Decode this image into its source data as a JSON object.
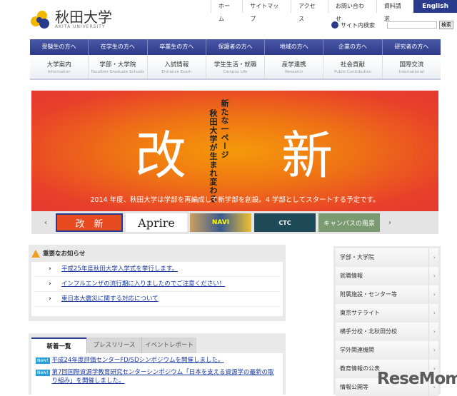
{
  "topbar": {
    "links": [
      "ホーム",
      "サイトマップ",
      "アクセス",
      "お問い合わせ",
      "資料請求"
    ],
    "english": "English"
  },
  "logo": {
    "name": "秋田大学",
    "sub": "AKITA UNIVERSITY"
  },
  "search": {
    "label": "サイト内検索",
    "button": "検索",
    "value": ""
  },
  "nav_primary": [
    "受験生の方へ",
    "在学生の方へ",
    "卒業生の方へ",
    "保護者の方へ",
    "地域の方へ",
    "企業の方へ",
    "研究者の方へ"
  ],
  "nav_secondary": [
    {
      "ja": "大学案内",
      "en": "Information"
    },
    {
      "ja": "学部・大学院",
      "en": "Faculties Graduate Schools"
    },
    {
      "ja": "入試情報",
      "en": "Entrance Exam"
    },
    {
      "ja": "学生生活・就職",
      "en": "Campus Life"
    },
    {
      "ja": "産学連携",
      "en": "Research"
    },
    {
      "ja": "社会貢献",
      "en": "Public Contribution"
    },
    {
      "ja": "国際交流",
      "en": "International"
    }
  ],
  "banner": {
    "big1": "改",
    "big2": "新",
    "vert1": "新たな一ページ",
    "vert2": "秋田大学が生まれ変わる",
    "caption": "2014 年度、秋田大学は学部を再編成して新学部を創設。4 学部としてスタートする予定です。"
  },
  "thumbs": {
    "prev": "‹",
    "next": "›",
    "items": [
      "改　新",
      "Aprire",
      "NAVI",
      "CTC",
      "キャンパスの風景"
    ]
  },
  "notice": {
    "title": "重要なお知らせ",
    "items": [
      "平成25年度秋田大学入学式を挙行します。",
      "インフルエンザの流行期に入りましたのでご注意ください！",
      "東日本大震災に関する対応について"
    ]
  },
  "news": {
    "tabs": [
      "新着一覧",
      "プレスリリース",
      "イベントレポート"
    ],
    "badge": "New!",
    "items": [
      "平成24年度評価センターFD/SDシンポジウムを開催しました。",
      "第7回国際資源学教育研究センターシンポジウム「日本を支える資源学の最新の取り組み」を開催しました。"
    ]
  },
  "sidebar": [
    "学部・大学院",
    "就職情報",
    "附属施設・センター等",
    "東京サテライト",
    "横手分校・北秋田分校",
    "学外関連機関",
    "教育情報の公表",
    "情報公開等"
  ],
  "watermark": "ReseMom"
}
